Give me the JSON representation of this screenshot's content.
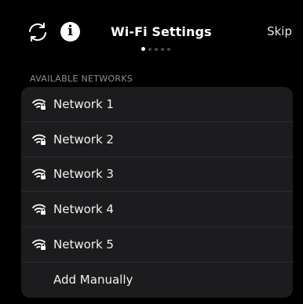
{
  "header": {
    "title": "Wi-Fi Settings",
    "skip_label": "Skip",
    "info_glyph": "i",
    "refresh_icon": "refresh-icon",
    "info_icon": "info-icon",
    "page_indicator": {
      "total": 5,
      "current": 1
    }
  },
  "networks_section": {
    "label": "AVAILABLE NETWORKS",
    "networks": [
      {
        "name": "Network 1",
        "icon": "wifi-locked-icon"
      },
      {
        "name": "Network 2",
        "icon": "wifi-locked-icon"
      },
      {
        "name": "Network 3",
        "icon": "wifi-locked-icon"
      },
      {
        "name": "Network 4",
        "icon": "wifi-locked-icon"
      },
      {
        "name": "Network 5",
        "icon": "wifi-locked-icon"
      }
    ],
    "add_manually_label": "Add Manually"
  },
  "colors": {
    "background": "#000000",
    "card": "#1c1c1e",
    "separator": "#2c2c2e",
    "secondary_text": "#8e8e93",
    "primary_text": "#ffffff"
  }
}
